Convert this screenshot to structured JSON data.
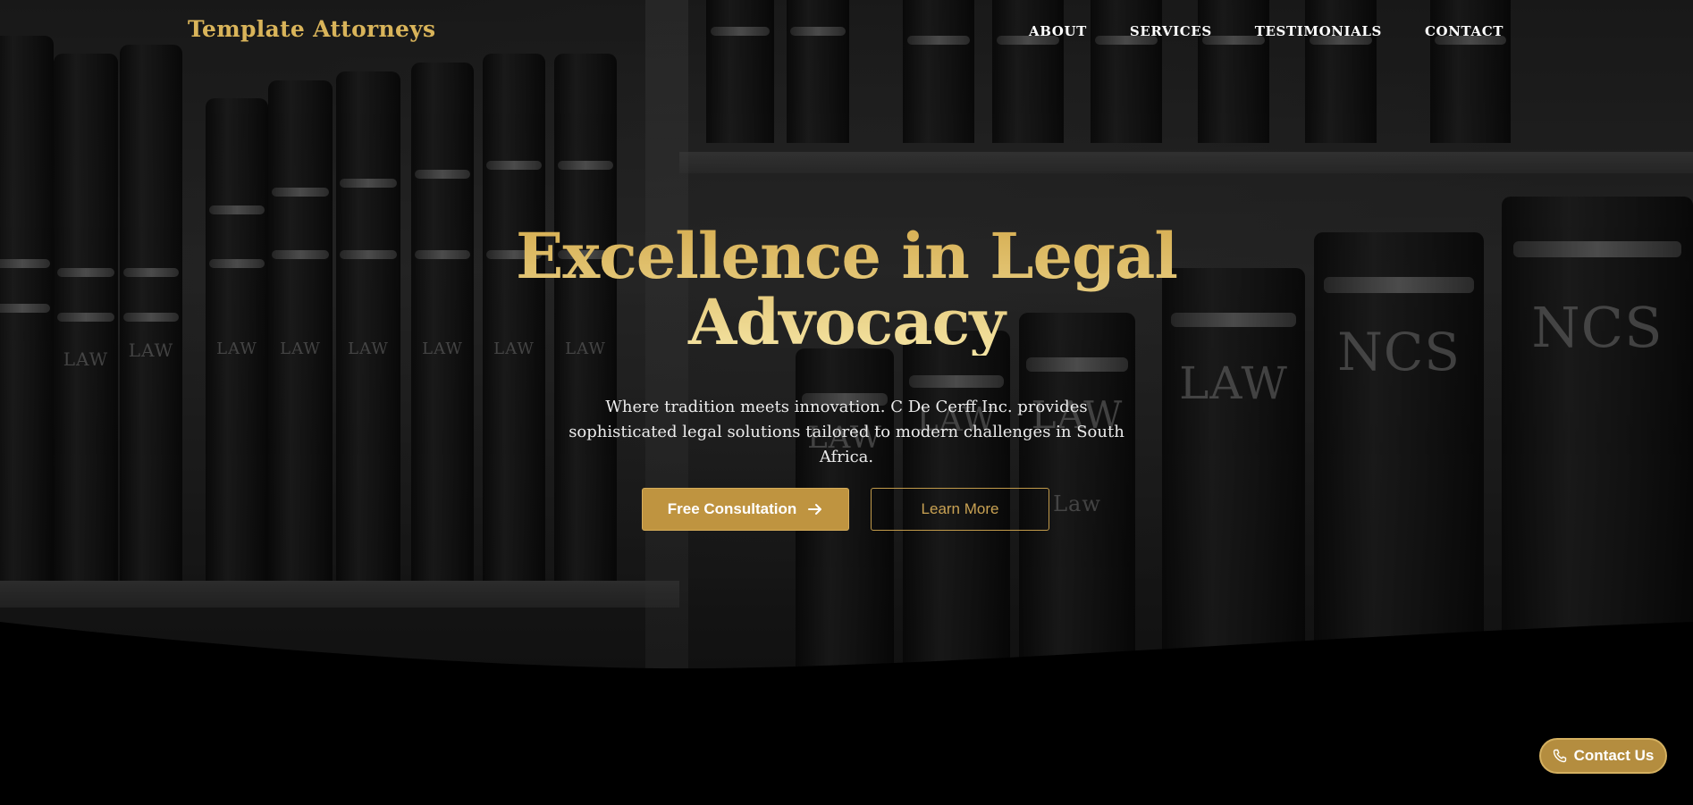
{
  "header": {
    "logo": "Template Attorneys",
    "nav": [
      "ABOUT",
      "SERVICES",
      "TESTIMONIALS",
      "CONTACT"
    ]
  },
  "hero": {
    "title_line1": "Excellence in Legal",
    "title_line2": "Advocacy",
    "subtitle": "Where tradition meets innovation. C De Cerff Inc. provides sophisticated legal solutions tailored to modern challenges in South Africa.",
    "primary_button": "Free Consultation",
    "primary_button_icon": "arrow-right-icon",
    "secondary_button": "Learn More"
  },
  "floating_contact": {
    "label": "Contact Us",
    "icon": "phone-icon"
  },
  "colors": {
    "accent_gold": "#bf9440",
    "title_gold": "#ecd38c",
    "background": "#000000",
    "nav_text": "#ffffff"
  }
}
